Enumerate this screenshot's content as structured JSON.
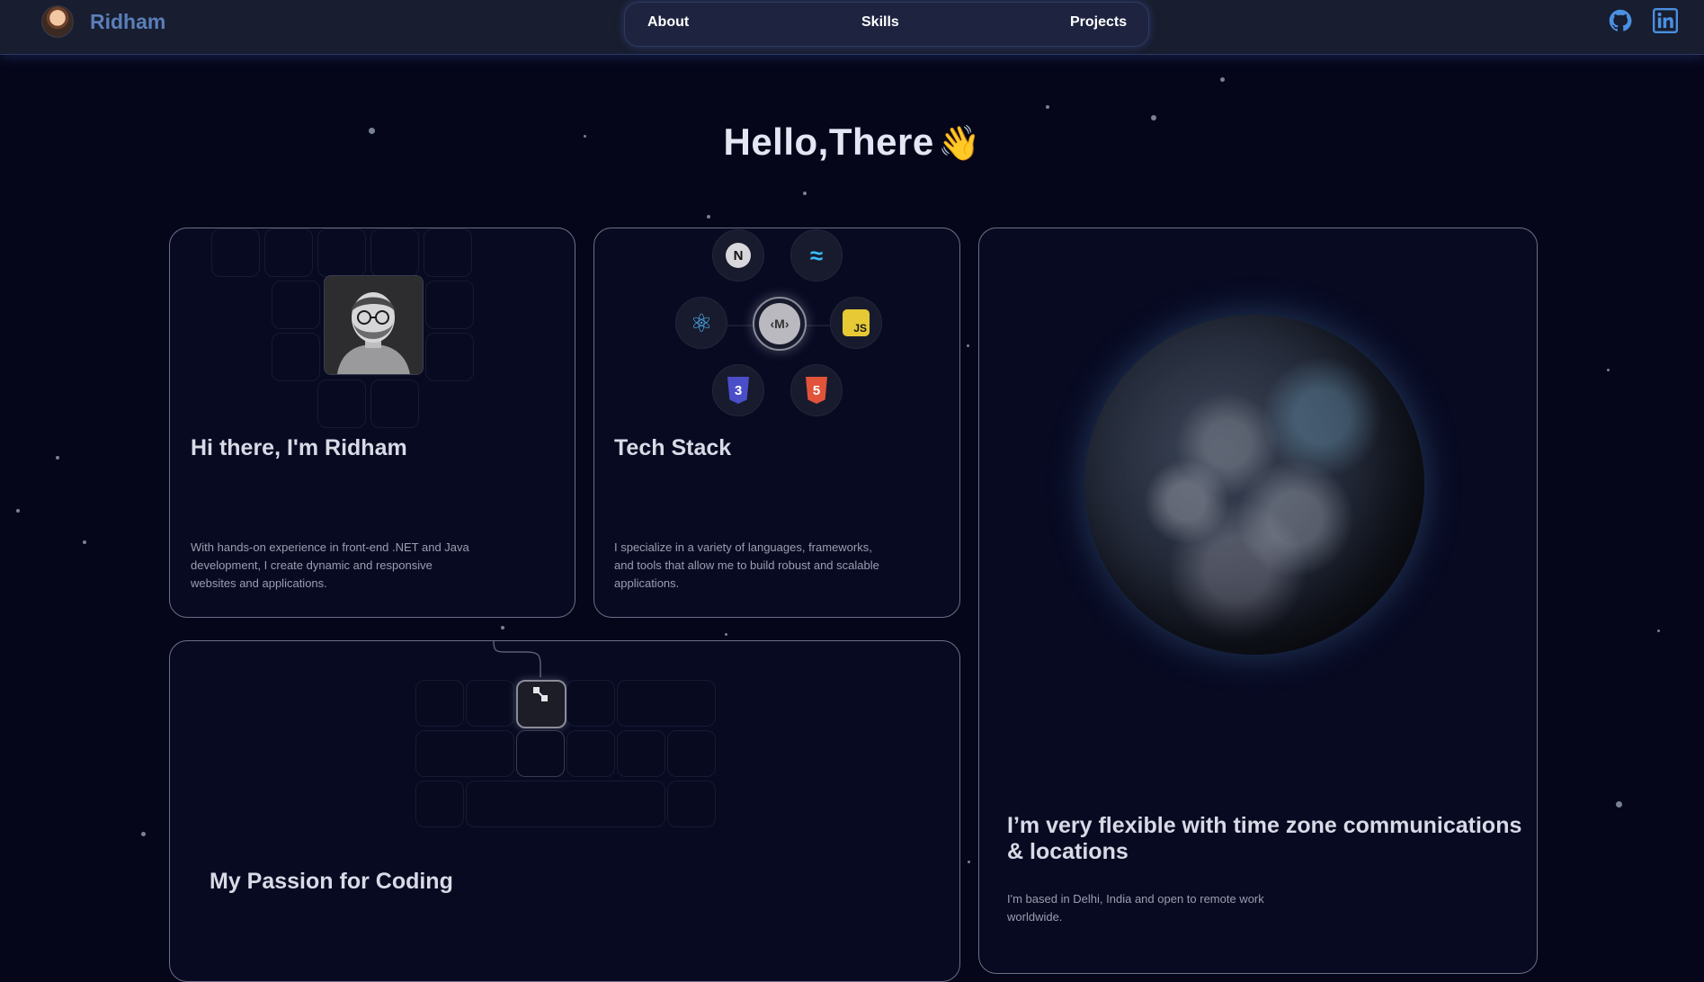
{
  "header": {
    "brand_name": "Ridham",
    "nav": [
      {
        "label": "About"
      },
      {
        "label": "Skills"
      },
      {
        "label": "Projects"
      }
    ],
    "social_icons": [
      "github-icon",
      "linkedin-icon"
    ]
  },
  "hero": {
    "title": "Hello,There",
    "emoji": "👋"
  },
  "cards": {
    "intro": {
      "title": "Hi there, I'm Ridham",
      "description": "With hands-on experience in front-end .NET and Java development, I create dynamic and responsive websites and applications."
    },
    "tech": {
      "title": "Tech Stack",
      "description": "I specialize in a variety of languages, frameworks, and tools that allow me to build robust and scalable applications.",
      "icons": [
        {
          "name": "nextjs-icon",
          "glyph": "N"
        },
        {
          "name": "tailwind-icon",
          "glyph": "≈"
        },
        {
          "name": "react-icon",
          "glyph": "⚛"
        },
        {
          "name": "markdown-icon",
          "glyph": "‹M›"
        },
        {
          "name": "javascript-icon",
          "glyph": "JS"
        },
        {
          "name": "css3-icon",
          "glyph": "3"
        },
        {
          "name": "html5-icon",
          "glyph": "5"
        }
      ]
    },
    "globe": {
      "title": "I’m very flexible with time zone communications & locations",
      "description": "I'm based in Delhi, India and open to remote work worldwide."
    },
    "passion": {
      "title": "My Passion for Coding"
    }
  },
  "colors": {
    "background": "#05061a",
    "brand": "#5a7fb8",
    "accent_blue": "#4a90e2"
  }
}
